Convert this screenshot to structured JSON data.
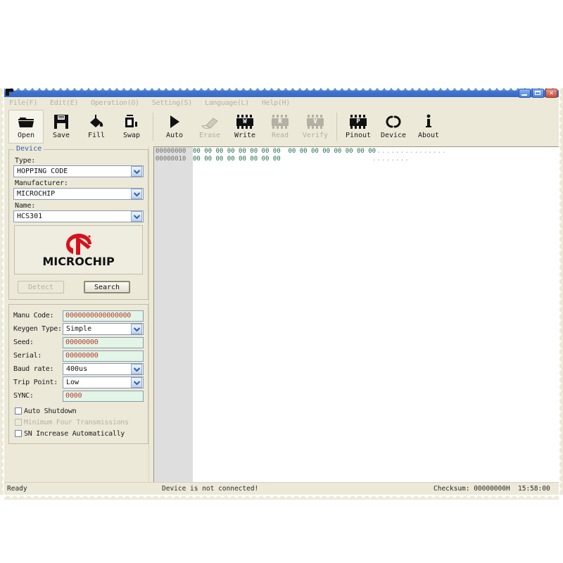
{
  "window": {
    "app_icon": "app-icon",
    "controls": [
      {
        "name": "minimize-button",
        "glyph": "–"
      },
      {
        "name": "maximize-button",
        "glyph": "□"
      },
      {
        "name": "close-button",
        "glyph": "✕"
      }
    ]
  },
  "menubar": {
    "items": [
      {
        "label": "File(F)"
      },
      {
        "label": "Edit(E)"
      },
      {
        "label": "Operation(O)"
      },
      {
        "label": "Setting(S)"
      },
      {
        "label": "Language(L)"
      },
      {
        "label": "Help(H)"
      }
    ]
  },
  "toolbar": {
    "buttons": [
      {
        "label": "Open",
        "icon": "folder-open-icon",
        "enabled": true,
        "active": true
      },
      {
        "label": "Save",
        "icon": "floppy-disk-icon",
        "enabled": true,
        "active": false
      },
      {
        "label": "Fill",
        "icon": "fill-bucket-icon",
        "enabled": true,
        "active": false
      },
      {
        "label": "Swap",
        "icon": "swap-icon",
        "enabled": true,
        "active": false
      },
      {
        "label": "Auto",
        "icon": "play-icon",
        "enabled": true,
        "active": false
      },
      {
        "label": "Erase",
        "icon": "eraser-icon",
        "enabled": false,
        "active": false
      },
      {
        "label": "Write",
        "icon": "chip-write-icon",
        "enabled": true,
        "active": false,
        "chip_letter": "W"
      },
      {
        "label": "Read",
        "icon": "chip-read-icon",
        "enabled": false,
        "active": false,
        "chip_letter": "R"
      },
      {
        "label": "Verify",
        "icon": "chip-verify-icon",
        "enabled": false,
        "active": false,
        "chip_letter": "V"
      },
      {
        "label": "Pinout",
        "icon": "chip-pinout-icon",
        "enabled": true,
        "active": false,
        "chip_letter": "P"
      },
      {
        "label": "Device",
        "icon": "link-chain-icon",
        "enabled": true,
        "active": false
      },
      {
        "label": "About",
        "icon": "info-icon",
        "enabled": true,
        "active": false
      }
    ]
  },
  "device_panel": {
    "legend": "Device",
    "type_label": "Type:",
    "type_value": "HOPPING CODE",
    "manufacturer_label": "Manufacturer:",
    "manufacturer_value": "MICROCHIP",
    "name_label": "Name:",
    "name_value": "HCS301",
    "logo_text": "MICROCHIP",
    "logo_color": "#d5121c",
    "detect_button": "Detect",
    "detect_enabled": false,
    "search_button": "Search",
    "search_enabled": true
  },
  "settings_panel": {
    "rows": [
      {
        "label": "Manu Code:",
        "type": "text",
        "value": "0000000000000000"
      },
      {
        "label": "Keygen Type:",
        "type": "combo",
        "value": "Simple"
      },
      {
        "label": "Seed:",
        "type": "text",
        "value": "00000000"
      },
      {
        "label": "Serial:",
        "type": "text",
        "value": "00000000"
      },
      {
        "label": "Baud rate:",
        "type": "combo",
        "value": "400us"
      },
      {
        "label": "Trip Point:",
        "type": "combo",
        "value": "Low"
      },
      {
        "label": "SYNC:",
        "type": "text",
        "value": "0000"
      }
    ],
    "checkboxes": [
      {
        "label": "Auto Shutdown",
        "checked": false,
        "enabled": true
      },
      {
        "label": "Minimum Four Transmissions",
        "checked": false,
        "enabled": false
      },
      {
        "label": "SN Increase Automatically",
        "checked": false,
        "enabled": true
      }
    ],
    "field_text_color": "#c0392b",
    "field_bg_color": "#e2f5e6"
  },
  "hex_view": {
    "rows": [
      {
        "address": "00000000",
        "bytes": "00 00 00 00 00 00 00 00  00 00 00 00 00 00 00 00",
        "ascii": "................"
      },
      {
        "address": "00000010",
        "bytes": "00 00 00 00 00 00 00 00",
        "ascii": "........"
      }
    ]
  },
  "statusbar": {
    "ready": "Ready",
    "device": "Device is not connected!",
    "checksum": "Checksum: 00000000H",
    "time": "15:58:00"
  }
}
